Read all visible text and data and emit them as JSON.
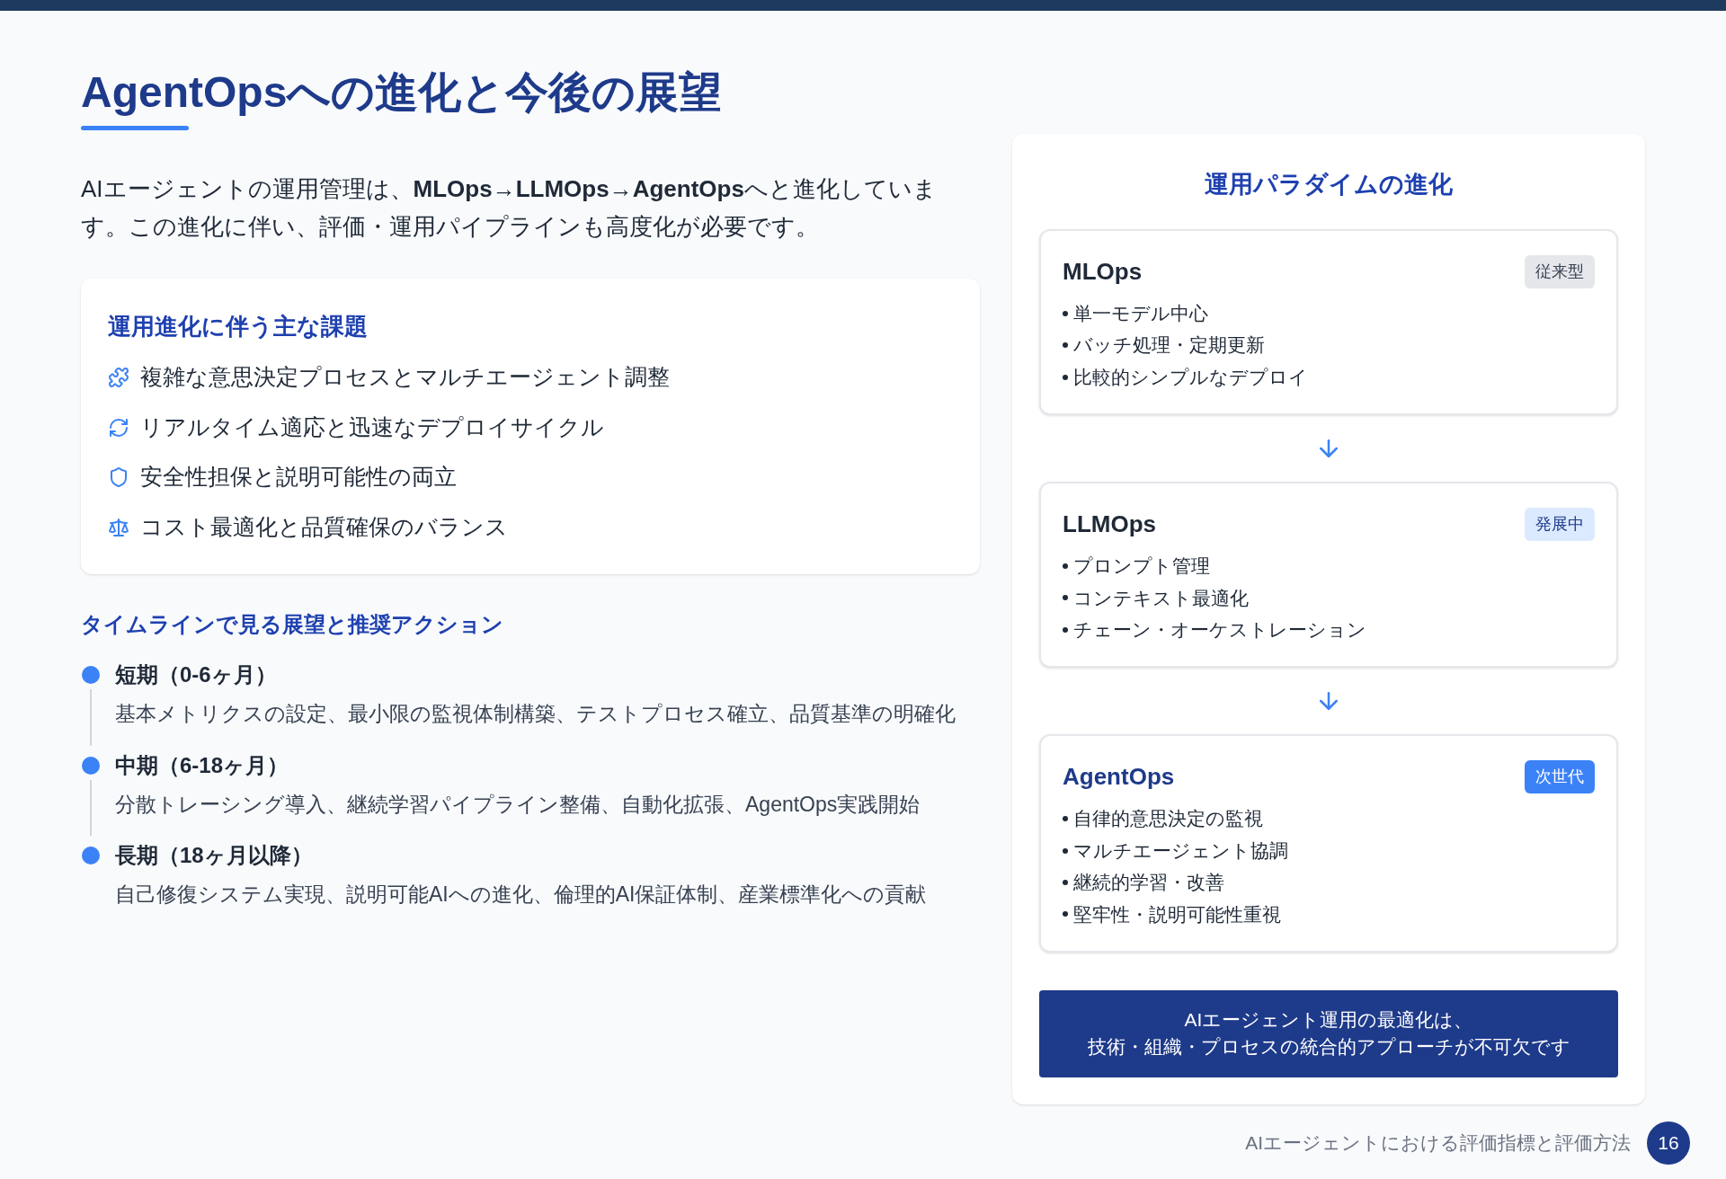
{
  "title": "AgentOpsへの進化と今後の展望",
  "intro": "AIエージェントの運用管理は、**MLOps→LLMOps→AgentOps**へと進化しています。この進化に伴い、評価・運用パイプラインも高度化が必要です。",
  "challenges": {
    "heading": "運用進化に伴う主な課題",
    "items": [
      {
        "kind": "puzzle",
        "text": "複雑な意思決定プロセスとマルチエージェント調整"
      },
      {
        "kind": "refresh",
        "text": "リアルタイム適応と迅速なデプロイサイクル"
      },
      {
        "kind": "shield",
        "text": "安全性担保と説明可能性の両立"
      },
      {
        "kind": "scale",
        "text": "コスト最適化と品質確保のバランス"
      }
    ]
  },
  "timeline": {
    "heading": "タイムラインで見る展望と推奨アクション",
    "items": [
      {
        "phase": "短期（0-6ヶ月）",
        "text": "基本メトリクスの設定、最小限の監視体制構築、テストプロセス確立、品質基準の明確化"
      },
      {
        "phase": "中期（6-18ヶ月）",
        "text": "分散トレーシング導入、継続学習パイプライン整備、自動化拡張、AgentOps実践開始"
      },
      {
        "phase": "長期（18ヶ月以降）",
        "text": "自己修復システム実現、説明可能AIへの進化、倫理的AI保証体制、産業標準化への貢献"
      }
    ]
  },
  "paradigm": {
    "heading": "運用パラダイムの進化",
    "stages": [
      {
        "kind": "legacy",
        "name": "MLOps",
        "badge": "従来型",
        "points": [
          "単一モデル中心",
          "バッチ処理・定期更新",
          "比較的シンプルなデプロイ"
        ]
      },
      {
        "kind": "developing",
        "name": "LLMOps",
        "badge": "発展中",
        "points": [
          "プロンプト管理",
          "コンテキスト最適化",
          "チェーン・オーケストレーション"
        ]
      },
      {
        "kind": "next",
        "name": "AgentOps",
        "badge": "次世代",
        "points": [
          "自律的意思決定の監視",
          "マルチエージェント協調",
          "継続的学習・改善",
          "堅牢性・説明可能性重視"
        ]
      }
    ],
    "conclusion": [
      "AIエージェント運用の最適化は、",
      "技術・組織・プロセスの統合的アプローチが不可欠です"
    ]
  },
  "footer": {
    "text": "AIエージェントにおける評価指標と評価方法",
    "page": "16"
  }
}
